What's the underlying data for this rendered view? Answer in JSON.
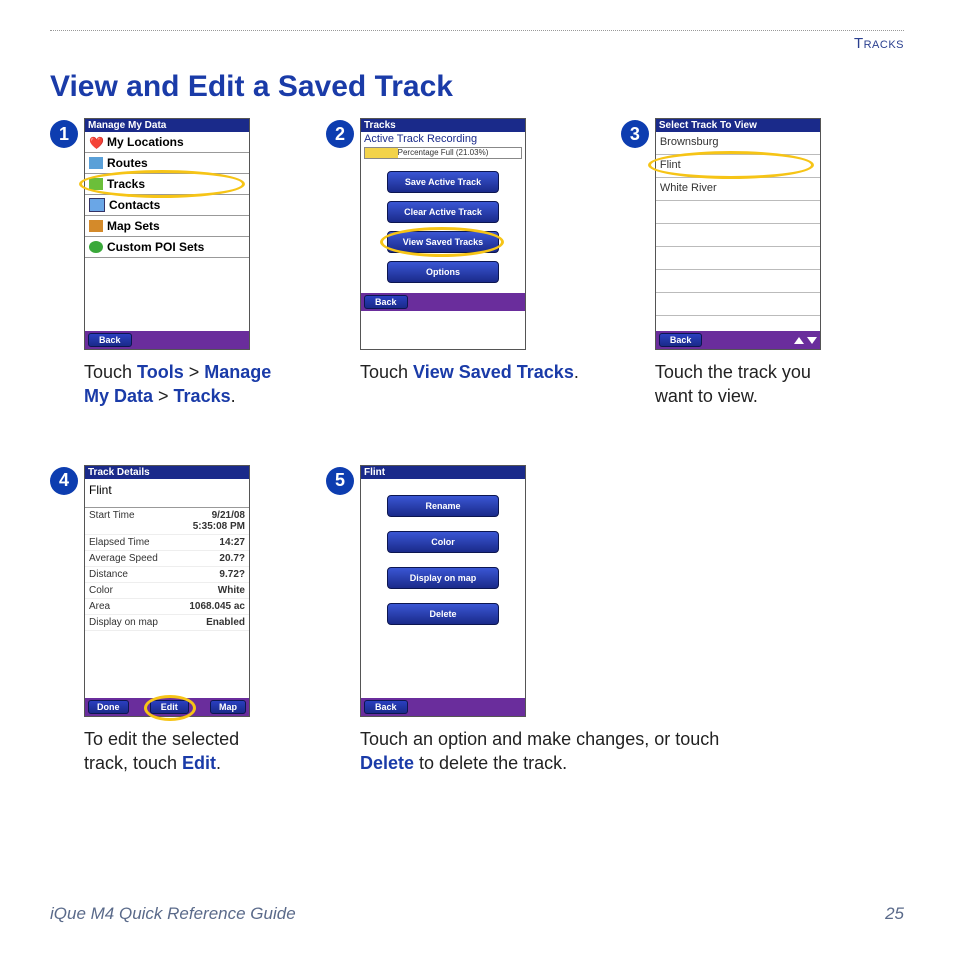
{
  "header": {
    "section": "Tracks"
  },
  "title": "View and Edit a Saved Track",
  "footer": {
    "guide": "iQue M4 Quick Reference Guide",
    "page": "25"
  },
  "steps": {
    "s1": {
      "num": "1",
      "screen_title": "Manage My Data",
      "items": [
        "My Locations",
        "Routes",
        "Tracks",
        "Contacts",
        "Map Sets",
        "Custom POI Sets"
      ],
      "back": "Back",
      "caption_pre": "Touch ",
      "c1": "Tools",
      "sep1": " > ",
      "c2": "Manage My Data",
      "sep2": " > ",
      "c3": "Tracks",
      "dot": "."
    },
    "s2": {
      "num": "2",
      "screen_title": "Tracks",
      "subtitle": "Active Track Recording",
      "pct_label": "Percentage Full (21.03%)",
      "buttons": [
        "Save Active Track",
        "Clear Active Track",
        "View Saved Tracks",
        "Options"
      ],
      "back": "Back",
      "caption_pre": "Touch ",
      "c1": "View Saved Tracks",
      "dot": "."
    },
    "s3": {
      "num": "3",
      "screen_title": "Select Track To View",
      "items": [
        "Brownsburg",
        "Flint",
        "White River"
      ],
      "back": "Back",
      "caption": "Touch the track you want to view."
    },
    "s4": {
      "num": "4",
      "screen_title": "Track Details",
      "name": "Flint",
      "rows": [
        {
          "l": "Start Time",
          "v": "9/21/08\n5:35:08 PM"
        },
        {
          "l": "Elapsed Time",
          "v": "14:27"
        },
        {
          "l": "Average Speed",
          "v": "20.7?"
        },
        {
          "l": "Distance",
          "v": "9.72?"
        },
        {
          "l": "Color",
          "v": "White"
        },
        {
          "l": "Area",
          "v": "1068.045 ac"
        },
        {
          "l": "Display on map",
          "v": "Enabled"
        }
      ],
      "done": "Done",
      "edit": "Edit",
      "map": "Map",
      "caption_pre": "To edit the selected track, touch ",
      "c1": "Edit",
      "dot": "."
    },
    "s5": {
      "num": "5",
      "screen_title": "Flint",
      "buttons": [
        "Rename",
        "Color",
        "Display on map",
        "Delete"
      ],
      "back": "Back",
      "caption_pre": "Touch an option and make changes, or touch ",
      "c1": "Delete",
      "caption_post": " to delete the track."
    }
  }
}
